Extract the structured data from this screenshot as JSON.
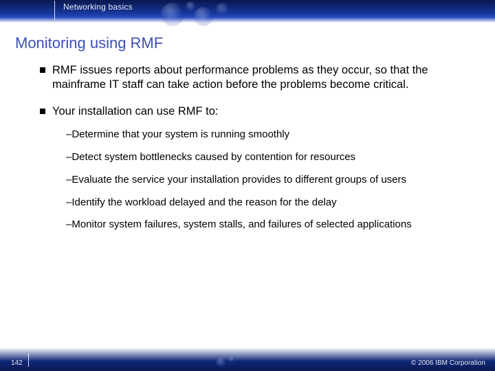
{
  "header": {
    "chapter": "Networking basics"
  },
  "title": "Monitoring using RMF",
  "bullets": [
    {
      "text": "RMF issues reports about performance problems as they occur, so that the mainframe IT staff can take action before the problems become critical."
    },
    {
      "text": "Your installation can use RMF to:",
      "sub": [
        "Determine that your system is running smoothly",
        "Detect system bottlenecks caused by contention for resources",
        "Evaluate the service your installation provides to different groups of users",
        "Identify the workload delayed and the reason for the delay",
        "Monitor system failures, system stalls, and failures of selected applications"
      ]
    }
  ],
  "footer": {
    "page": "142",
    "copyright": "© 2006 IBM Corporation"
  }
}
